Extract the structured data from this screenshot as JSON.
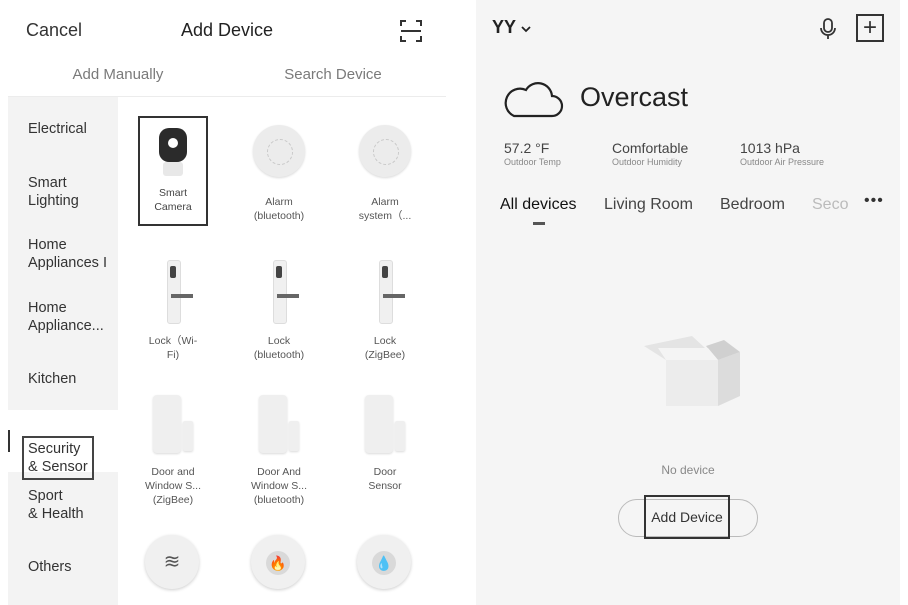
{
  "left": {
    "cancel": "Cancel",
    "title": "Add Device",
    "tabs": [
      "Add Manually",
      "Search Device"
    ],
    "categories": [
      {
        "label": "Electrical"
      },
      {
        "label": "Smart\nLighting"
      },
      {
        "label": "Home\nAppliances I"
      },
      {
        "label": "Home\nAppliance..."
      },
      {
        "label": "Kitchen"
      },
      {
        "label": "Security\n& Sensor"
      },
      {
        "label": "Sport\n& Health"
      },
      {
        "label": "Others"
      }
    ],
    "devices": [
      {
        "label": "Smart\nCamera"
      },
      {
        "label": "Alarm\n(bluetooth)"
      },
      {
        "label": "Alarm\nsystem（..."
      },
      {
        "label": "Lock（Wi-\nFi)"
      },
      {
        "label": "Lock\n(bluetooth)"
      },
      {
        "label": "Lock\n(ZigBee)"
      },
      {
        "label": "Door and\nWindow S...\n(ZigBee)"
      },
      {
        "label": "Door And\nWindow S...\n(bluetooth)"
      },
      {
        "label": "Door\nSensor"
      }
    ]
  },
  "right": {
    "home": "YY",
    "weather": "Overcast",
    "stats": [
      {
        "value": "57.2 °F",
        "label": "Outdoor Temp"
      },
      {
        "value": "Comfortable",
        "label": "Outdoor Humidity"
      },
      {
        "value": "1013 hPa",
        "label": "Outdoor Air Pressure"
      }
    ],
    "tabs": [
      "All devices",
      "Living Room",
      "Bedroom",
      "Seco"
    ],
    "more": "•••",
    "empty_text": "No device",
    "add_button": "Add Device"
  }
}
